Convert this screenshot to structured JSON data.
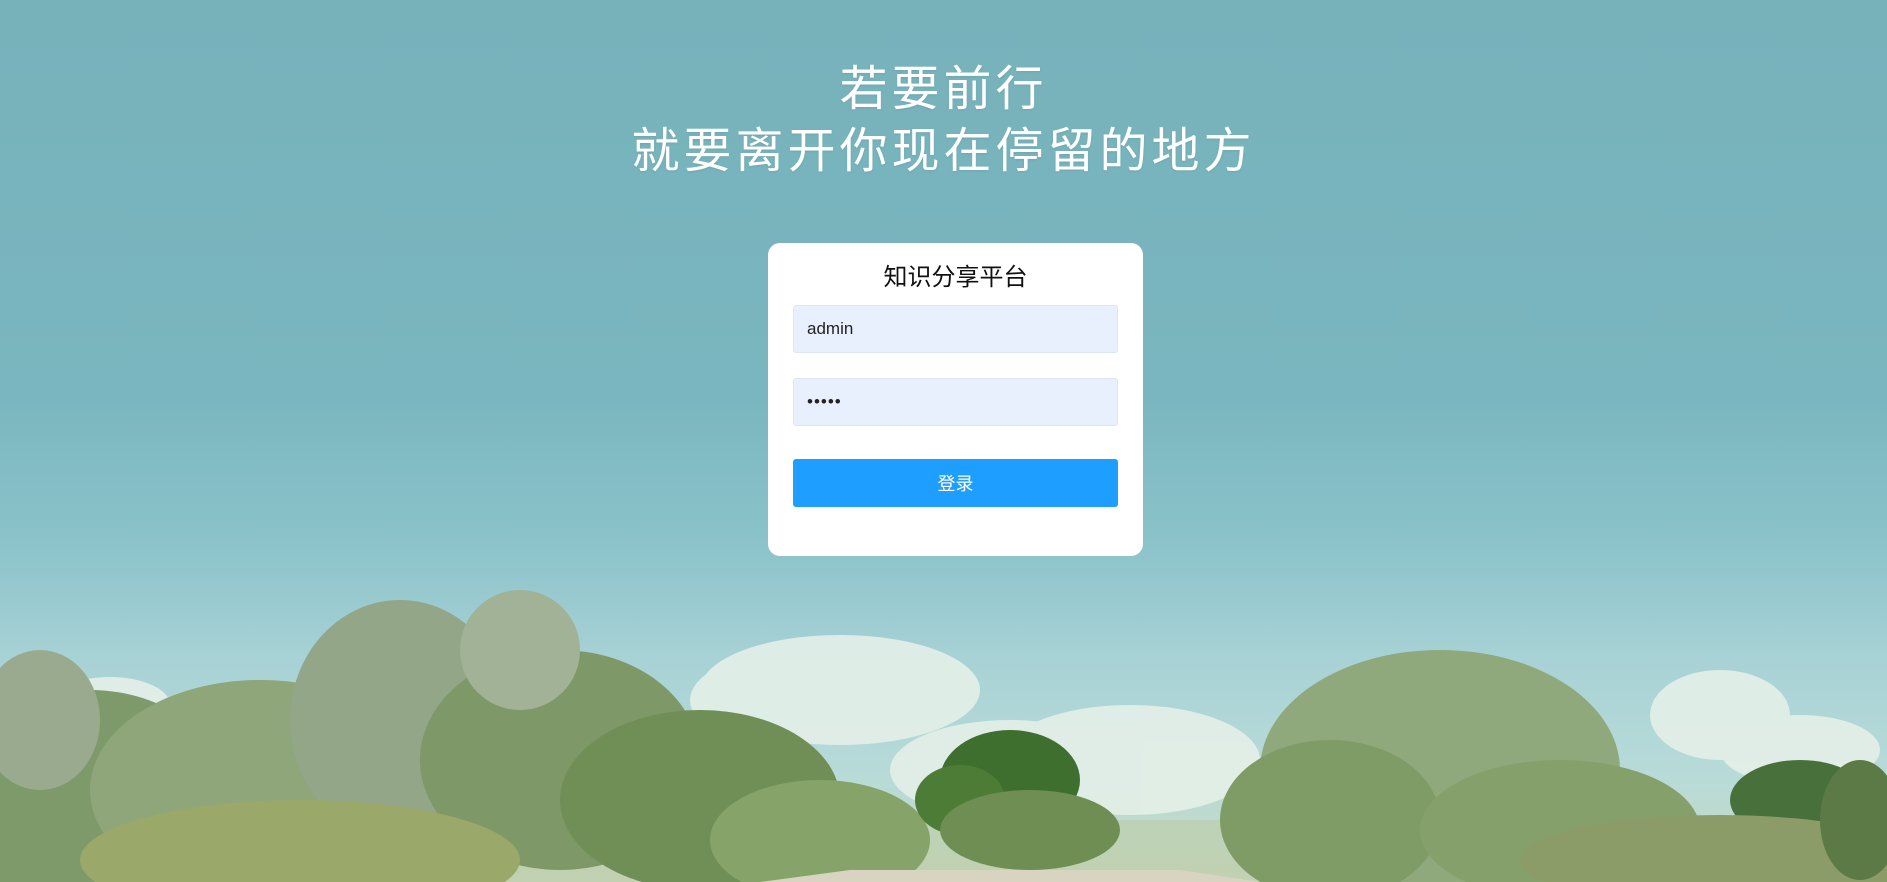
{
  "slogan": {
    "line1": "若要前行",
    "line2": "就要离开你现在停留的地方"
  },
  "login": {
    "title": "知识分享平台",
    "username_value": "admin",
    "password_value": "•••••",
    "button_label": "登录"
  },
  "colors": {
    "sky": "#7ab6bf",
    "button": "#1e9fff",
    "input_bg": "#e8f0fe",
    "card": "#ffffff"
  }
}
